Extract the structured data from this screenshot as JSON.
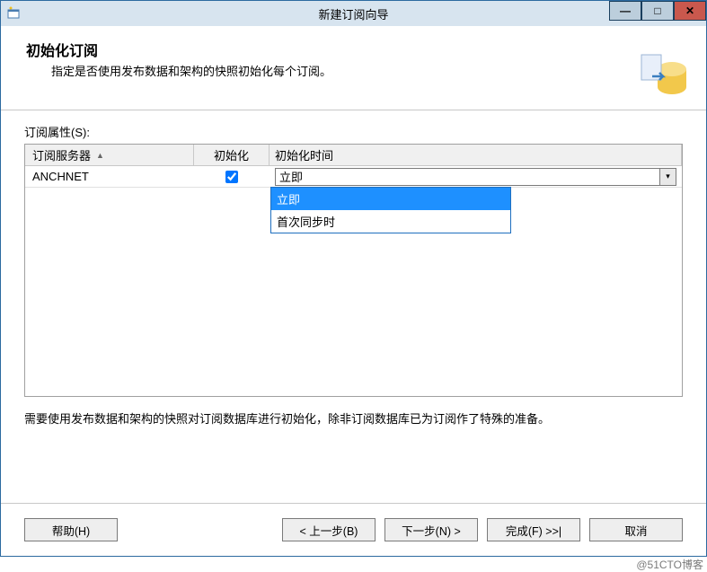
{
  "window": {
    "title": "新建订阅向导",
    "buttons": {
      "min": "—",
      "max": "□",
      "close": "✕"
    }
  },
  "header": {
    "title": "初始化订阅",
    "subtitle": "指定是否使用发布数据和架构的快照初始化每个订阅。"
  },
  "content": {
    "properties_label": "订阅属性(S):",
    "columns": {
      "server": "订阅服务器",
      "init": "初始化",
      "init_time": "初始化时间"
    },
    "rows": [
      {
        "server": "ANCHNET",
        "init_checked": true,
        "init_time_selected": "立即"
      }
    ],
    "dropdown_options": [
      "立即",
      "首次同步时"
    ],
    "note": "需要使用发布数据和架构的快照对订阅数据库进行初始化，除非订阅数据库已为订阅作了特殊的准备。"
  },
  "footer": {
    "help": "帮助(H)",
    "back": "< 上一步(B)",
    "next": "下一步(N) >",
    "finish": "完成(F) >>|",
    "cancel": "取消"
  },
  "watermark": "@51CTO博客"
}
